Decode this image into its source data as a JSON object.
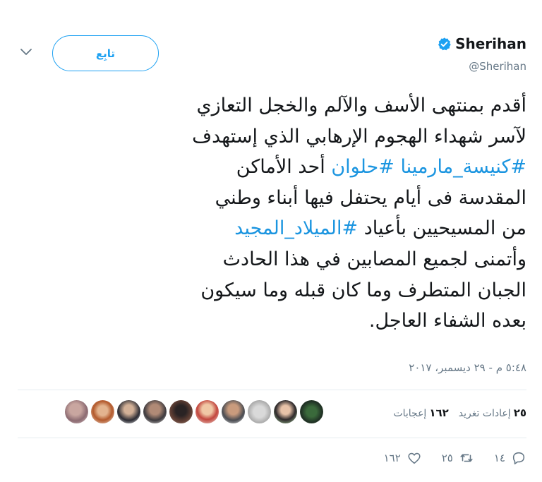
{
  "header": {
    "display_name": "Sherihan",
    "handle": "@Sherihan",
    "follow_label": "تابِع"
  },
  "tweet": {
    "line1": "أقدم بمنتهى الأسف والآلم والخجل التعازي",
    "line2": "لآسر شهداء الهجوم الإرهابي الذي إستهدف",
    "line3_tag1": "#كنيسة_مارمينا",
    "line3_tag2": "#حلوان",
    "line3_rest": "أحد الأماكن",
    "line4": "المقدسة فى أيام يحتفل فيها أبناء وطني",
    "line5_pre": "من المسيحيين بأعياد",
    "line5_tag": "#الميلاد_المجيد",
    "line6": "وأتمنى لجميع المصابين في هذا الحادث",
    "line7": "الجبان المتطرف وما كان قبله وما سيكون",
    "line8": "بعده الشفاء العاجل."
  },
  "timestamp": "٥:٤٨ م - ٢٩ ديسمبر، ٢٠١٧",
  "stats": {
    "retweets_count": "٢٥",
    "retweets_label": "إعادات تغريد",
    "likes_count": "١٦٢",
    "likes_label": "إعجابات"
  },
  "actions": {
    "reply_count": "١٤",
    "retweet_count": "٢٥",
    "like_count": "١٦٢"
  },
  "colors": {
    "accent": "#1da1f2",
    "hashtag": "#1b95e0",
    "muted": "#657786"
  },
  "avatar_count": 10
}
